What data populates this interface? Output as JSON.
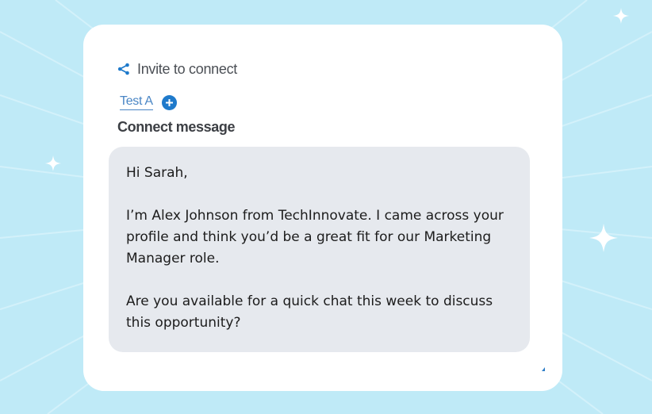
{
  "colors": {
    "background": "#bfeaf7",
    "card": "#ffffff",
    "message_bg": "#e6e9ee",
    "accent": "#1f7acb",
    "tab_link": "#4a86c5"
  },
  "icons": {
    "share": "share-icon",
    "add": "plus-circle-icon",
    "sparkle": "sparkle-icon"
  },
  "header": {
    "invite_label": "Invite to connect"
  },
  "tabs": [
    {
      "label": "Test A",
      "active": true
    }
  ],
  "section": {
    "title": "Connect message"
  },
  "message": {
    "greeting": "Hi Sarah,",
    "body_1": "I’m Alex Johnson from TechInnovate. I came across your profile and think you’d be a great fit for our Marketing Manager role.",
    "body_2": "Are you available for a quick chat this week to discuss this opportunity?"
  }
}
